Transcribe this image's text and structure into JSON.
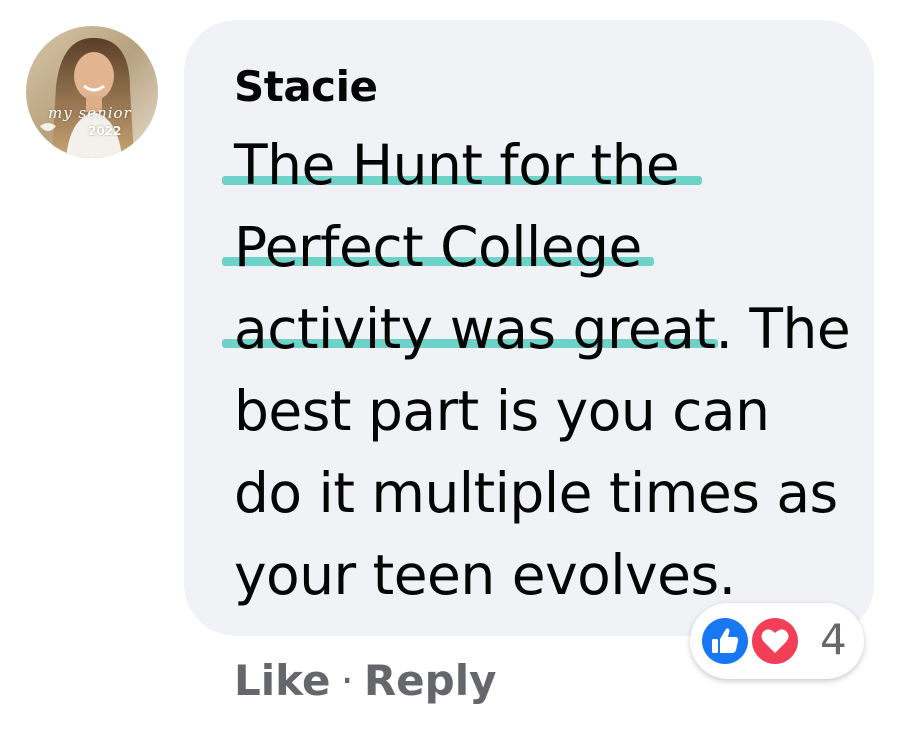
{
  "comment": {
    "author": "Stacie",
    "avatar": {
      "caption": "my senior",
      "year": "2022"
    },
    "lines": [
      "The Hunt for the",
      "Perfect College",
      "activity was great. The",
      "best part is you can",
      "do it multiple times as",
      "your teen evolves."
    ],
    "highlight_color": "#6dd3c8",
    "bubble_color": "#f0f2f5"
  },
  "actions": {
    "like_label": "Like",
    "separator": "·",
    "reply_label": "Reply"
  },
  "reactions": {
    "icons": [
      "like-icon",
      "love-icon"
    ],
    "count": "4",
    "like_color": "#1877f2",
    "love_color": "#f33e58"
  }
}
